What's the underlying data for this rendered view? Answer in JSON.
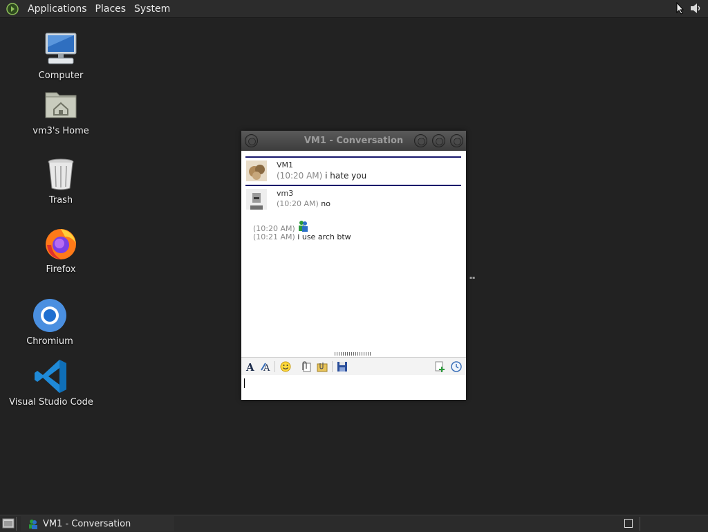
{
  "top_panel": {
    "menus": [
      "Applications",
      "Places",
      "System"
    ]
  },
  "desktop": {
    "icons": [
      {
        "label": "Computer",
        "icon": "computer-icon"
      },
      {
        "label": "vm3's Home",
        "icon": "home-folder-icon"
      },
      {
        "label": "Trash",
        "icon": "trash-icon"
      },
      {
        "label": "Firefox",
        "icon": "firefox-icon"
      },
      {
        "label": "Chromium",
        "icon": "chromium-icon"
      },
      {
        "label": "Visual Studio Code",
        "icon": "vscode-icon"
      }
    ]
  },
  "conversation_window": {
    "title": "VM1 - Conversation",
    "messages": [
      {
        "sender": "VM1",
        "lines": [
          {
            "time": "(10:20 AM)",
            "text": "i hate you"
          }
        ]
      },
      {
        "sender": "vm3",
        "lines": [
          {
            "time": "(10:20 AM)",
            "text": "no"
          },
          {
            "time": "(10:20 AM)",
            "text": "",
            "emoticon": "msn-buddy-icon"
          },
          {
            "time": "(10:21 AM)",
            "text": "i use arch btw"
          }
        ]
      }
    ],
    "input_value": ""
  },
  "taskbar": {
    "items": [
      {
        "label": "VM1 - Conversation",
        "icon": "chat-icon"
      }
    ]
  },
  "colors": {
    "desktop_bg": "#222222",
    "panel_bg": "#2c2c2c",
    "message_divider": "#16166b",
    "timestamp": "#888888"
  }
}
